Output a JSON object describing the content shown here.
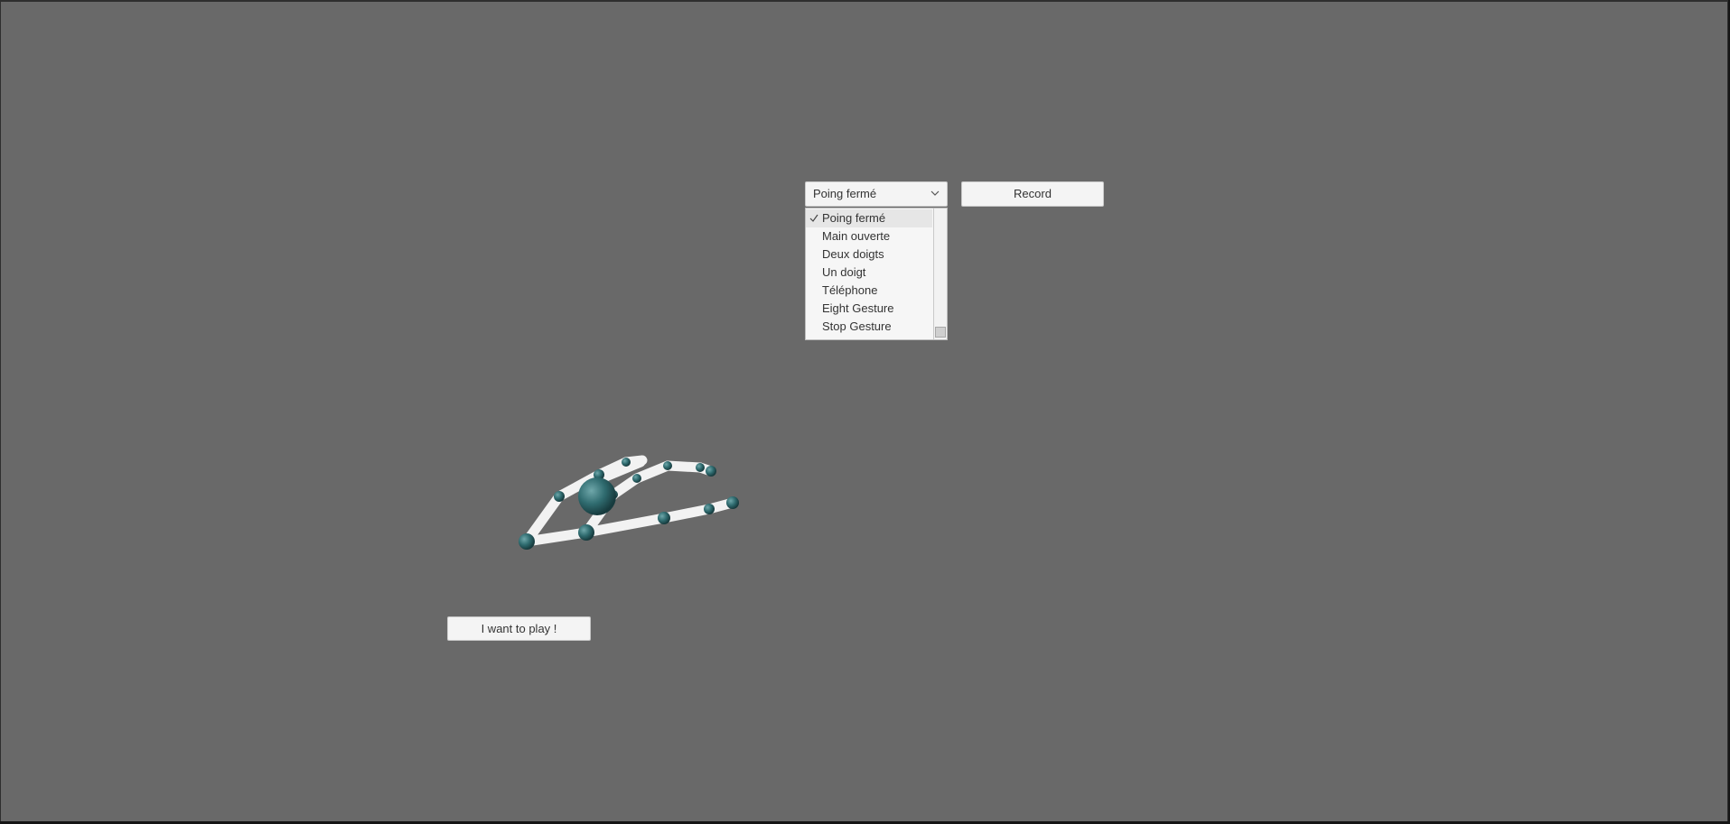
{
  "dropdown": {
    "selected": "Poing fermé",
    "options": [
      "Poing fermé",
      "Main ouverte",
      "Deux doigts",
      "Un doigt",
      "Téléphone",
      "Eight Gesture",
      "Stop Gesture"
    ]
  },
  "buttons": {
    "record": "Record",
    "play": "I want to play !"
  },
  "colors": {
    "background": "#696969",
    "joint": "#2f6b6f",
    "bone": "#ffffff"
  },
  "icons": {
    "dropdown": "chevron-down-icon",
    "selected": "check-icon"
  }
}
